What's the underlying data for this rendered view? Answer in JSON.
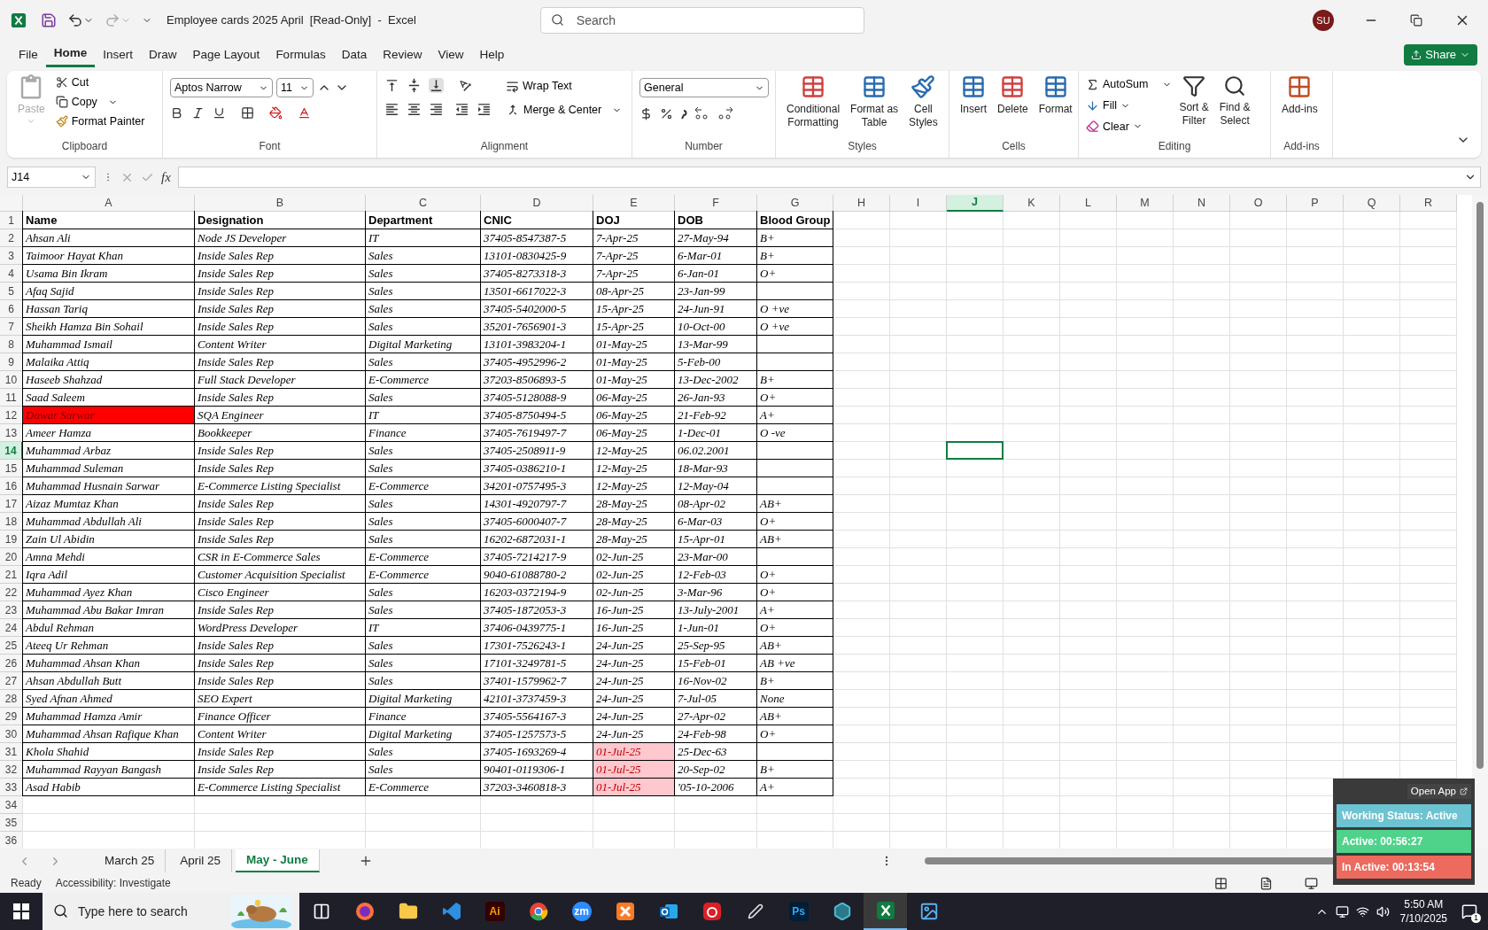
{
  "title_bar": {
    "title": "Employee cards 2025 April  [Read-Only]  -  Excel",
    "search": {
      "placeholder": "Search"
    },
    "avatar": "SU"
  },
  "menu_tabs": [
    {
      "label": "File",
      "selected": false
    },
    {
      "label": "Home",
      "selected": true
    },
    {
      "label": "Insert",
      "selected": false
    },
    {
      "label": "Draw",
      "selected": false
    },
    {
      "label": "Page Layout",
      "selected": false
    },
    {
      "label": "Formulas",
      "selected": false
    },
    {
      "label": "Data",
      "selected": false
    },
    {
      "label": "Review",
      "selected": false
    },
    {
      "label": "View",
      "selected": false
    },
    {
      "label": "Help",
      "selected": false
    }
  ],
  "share": "Share",
  "ribbon": {
    "clipboard": {
      "label": "Clipboard",
      "paste": {
        "label": "Paste",
        "disabled": true
      },
      "cut": "Cut",
      "copy": "Copy",
      "format_painter": "Format Painter"
    },
    "font": {
      "label": "Font",
      "font_name": "Aptos Narrow",
      "font_size": "11"
    },
    "alignment": {
      "label": "Alignment",
      "wrap_text": "Wrap Text",
      "merge_center": "Merge & Center"
    },
    "number": {
      "label": "Number",
      "format": "General"
    },
    "styles": {
      "label": "Styles",
      "conditional_formatting": "Conditional\nFormatting",
      "format_as_table": "Format as\nTable",
      "cell_styles": "Cell\nStyles"
    },
    "cells": {
      "label": "Cells",
      "insert": "Insert",
      "delete": "Delete",
      "format": "Format"
    },
    "editing": {
      "label": "Editing",
      "autosum": "AutoSum",
      "fill": "Fill",
      "clear": "Clear",
      "sort_filter": "Sort &\nFilter",
      "find_select": "Find &\nSelect"
    },
    "addins": {
      "label": "Add-ins",
      "addins": "Add-ins"
    }
  },
  "formula_bar": {
    "name_box": "J14",
    "function_label": "fx"
  },
  "sheet": {
    "columns": [
      {
        "label": "A",
        "selected": false
      },
      {
        "label": "B",
        "selected": false
      },
      {
        "label": "C",
        "selected": false
      },
      {
        "label": "D",
        "selected": false
      },
      {
        "label": "E",
        "selected": false
      },
      {
        "label": "F",
        "selected": false
      },
      {
        "label": "G",
        "selected": false
      },
      {
        "label": "H",
        "selected": false
      },
      {
        "label": "I",
        "selected": false
      },
      {
        "label": "J",
        "selected": true
      },
      {
        "label": "K",
        "selected": false
      },
      {
        "label": "L",
        "selected": false
      },
      {
        "label": "M",
        "selected": false
      },
      {
        "label": "N",
        "selected": false
      },
      {
        "label": "O",
        "selected": false
      },
      {
        "label": "P",
        "selected": false
      },
      {
        "label": "Q",
        "selected": false
      },
      {
        "label": "R",
        "selected": false
      }
    ],
    "header_row": {
      "number": "1",
      "selected": false,
      "name": "Name",
      "designation": "Designation",
      "department": "Department",
      "cnic": "CNIC",
      "doj": "DOJ",
      "dob": "DOB",
      "blood_group": "Blood Group"
    },
    "rows": [
      {
        "number": "2",
        "selected": false,
        "name_highlight": false,
        "doj_highlight": false,
        "name": "Ahsan Ali",
        "designation": "Node JS Developer",
        "department": "IT",
        "cnic": "37405-8547387-5",
        "doj": "7-Apr-25",
        "dob": "27-May-94",
        "blood_group": "B+"
      },
      {
        "number": "3",
        "selected": false,
        "name_highlight": false,
        "doj_highlight": false,
        "name": "Taimoor Hayat Khan",
        "designation": "Inside Sales Rep",
        "department": "Sales",
        "cnic": "13101-0830425-9",
        "doj": "7-Apr-25",
        "dob": "6-Mar-01",
        "blood_group": "B+"
      },
      {
        "number": "4",
        "selected": false,
        "name_highlight": false,
        "doj_highlight": false,
        "name": "Usama Bin Ikram",
        "designation": "Inside Sales Rep",
        "department": "Sales",
        "cnic": "37405-8273318-3",
        "doj": "7-Apr-25",
        "dob": "6-Jan-01",
        "blood_group": "O+"
      },
      {
        "number": "5",
        "selected": false,
        "name_highlight": false,
        "doj_highlight": false,
        "name": "Afaq Sajid",
        "designation": "Inside Sales Rep",
        "department": "Sales",
        "cnic": "13501-6617022-3",
        "doj": "08-Apr-25",
        "dob": "23-Jan-99"
      },
      {
        "number": "6",
        "selected": false,
        "name_highlight": false,
        "doj_highlight": false,
        "name": "Hassan Tariq",
        "designation": "Inside Sales Rep",
        "department": "Sales",
        "cnic": "37405-5402000-5",
        "doj": "15-Apr-25",
        "dob": "24-Jun-91",
        "blood_group": "O +ve"
      },
      {
        "number": "7",
        "selected": false,
        "name_highlight": false,
        "doj_highlight": false,
        "name": "Sheikh Hamza Bin Sohail",
        "designation": "Inside Sales Rep",
        "department": "Sales",
        "cnic": "35201-7656901-3",
        "doj": "15-Apr-25",
        "dob": "10-Oct-00",
        "blood_group": "O +ve"
      },
      {
        "number": "8",
        "selected": false,
        "name_highlight": false,
        "doj_highlight": false,
        "name": "Muhammad Ismail",
        "designation": "Content Writer",
        "department": "Digital Marketing",
        "cnic": "13101-3983204-1",
        "doj": "01-May-25",
        "dob": "13-Mar-99"
      },
      {
        "number": "9",
        "selected": false,
        "name_highlight": false,
        "doj_highlight": false,
        "name": "Malaika Attiq",
        "designation": "Inside Sales Rep",
        "department": "Sales",
        "cnic": "37405-4952996-2",
        "doj": "01-May-25",
        "dob": "5-Feb-00"
      },
      {
        "number": "10",
        "selected": false,
        "name_highlight": false,
        "doj_highlight": false,
        "name": "Haseeb Shahzad",
        "designation": "Full Stack Developer",
        "department": "E-Commerce",
        "cnic": "37203-8506893-5",
        "doj": "01-May-25",
        "dob": "13-Dec-2002",
        "blood_group": "B+"
      },
      {
        "number": "11",
        "selected": false,
        "name_highlight": false,
        "doj_highlight": false,
        "name": "Saad Saleem",
        "designation": "Inside Sales Rep",
        "department": "Sales",
        "cnic": "37405-5128088-9",
        "doj": "06-May-25",
        "dob": "26-Jan-93",
        "blood_group": "O+"
      },
      {
        "number": "12",
        "selected": false,
        "name_highlight": true,
        "doj_highlight": false,
        "name": "Dawar Sarwar",
        "designation": "SQA Engineer",
        "department": "IT",
        "cnic": "37405-8750494-5",
        "doj": "06-May-25",
        "dob": "21-Feb-92",
        "blood_group": "A+"
      },
      {
        "number": "13",
        "selected": false,
        "name_highlight": false,
        "doj_highlight": false,
        "name": "Ameer Hamza",
        "designation": "Bookkeeper",
        "department": "Finance",
        "cnic": "37405-7619497-7",
        "doj": "06-May-25",
        "dob": "1-Dec-01",
        "blood_group": "O -ve"
      },
      {
        "number": "14",
        "selected": true,
        "name_highlight": false,
        "doj_highlight": false,
        "name": "Muhammad Arbaz",
        "designation": "Inside Sales Rep",
        "department": "Sales",
        "cnic": "37405-2508911-9",
        "doj": "12-May-25",
        "dob": "06.02.2001"
      },
      {
        "number": "15",
        "selected": false,
        "name_highlight": false,
        "doj_highlight": false,
        "name": "Muhammad Suleman",
        "designation": "Inside Sales Rep",
        "department": "Sales",
        "cnic": "37405-0386210-1",
        "doj": "12-May-25",
        "dob": "18-Mar-93"
      },
      {
        "number": "16",
        "selected": false,
        "name_highlight": false,
        "doj_highlight": false,
        "name": "Muhammad Husnain Sarwar",
        "designation": "E-Commerce Listing Specialist",
        "department": "E-Commerce",
        "cnic": "34201-0757495-3",
        "doj": "12-May-25",
        "dob": "12-May-04"
      },
      {
        "number": "17",
        "selected": false,
        "name_highlight": false,
        "doj_highlight": false,
        "name": "Aizaz Mumtaz Khan",
        "designation": "Inside Sales Rep",
        "department": "Sales",
        "cnic": "14301-4920797-7",
        "doj": "28-May-25",
        "dob": "08-Apr-02",
        "blood_group": "AB+"
      },
      {
        "number": "18",
        "selected": false,
        "name_highlight": false,
        "doj_highlight": false,
        "name": "Muhammad Abdullah Ali",
        "designation": "Inside Sales Rep",
        "department": "Sales",
        "cnic": "37405-6000407-7",
        "doj": "28-May-25",
        "dob": "6-Mar-03",
        "blood_group": "O+"
      },
      {
        "number": "19",
        "selected": false,
        "name_highlight": false,
        "doj_highlight": false,
        "name": "Zain Ul Abidin",
        "designation": "Inside Sales Rep",
        "department": "Sales",
        "cnic": "16202-6872031-1",
        "doj": "28-May-25",
        "dob": "15-Apr-01",
        "blood_group": "AB+"
      },
      {
        "number": "20",
        "selected": false,
        "name_highlight": false,
        "doj_highlight": false,
        "name": "Amna Mehdi",
        "designation": "CSR in E-Commerce Sales",
        "department": "E-Commerce",
        "cnic": "37405-7214217-9",
        "doj": "02-Jun-25",
        "dob": "23-Mar-00"
      },
      {
        "number": "21",
        "selected": false,
        "name_highlight": false,
        "doj_highlight": false,
        "name": "Iqra Adil",
        "designation": "Customer Acquisition Specialist",
        "department": "E-Commerce",
        "cnic": "9040-61088780-2",
        "doj": "02-Jun-25",
        "dob": "12-Feb-03",
        "blood_group": "O+"
      },
      {
        "number": "22",
        "selected": false,
        "name_highlight": false,
        "doj_highlight": false,
        "name": "Muhammad Ayez Khan",
        "designation": "Cisco Engineer",
        "department": "Sales",
        "cnic": "16203-0372194-9",
        "doj": "02-Jun-25",
        "dob": "3-Mar-96",
        "blood_group": "O+"
      },
      {
        "number": "23",
        "selected": false,
        "name_highlight": false,
        "doj_highlight": false,
        "name": "Muhammad Abu Bakar Imran",
        "designation": "Inside Sales Rep",
        "department": "Sales",
        "cnic": "37405-1872053-3",
        "doj": "16-Jun-25",
        "dob": "13-July-2001",
        "blood_group": "A+"
      },
      {
        "number": "24",
        "selected": false,
        "name_highlight": false,
        "doj_highlight": false,
        "name": "Abdul Rehman",
        "designation": "WordPress Developer",
        "department": "IT",
        "cnic": "37406-0439775-1",
        "doj": "16-Jun-25",
        "dob": "1-Jun-01",
        "blood_group": "O+"
      },
      {
        "number": "25",
        "selected": false,
        "name_highlight": false,
        "doj_highlight": false,
        "name": "Ateeq Ur Rehman",
        "designation": "Inside Sales Rep",
        "department": "Sales",
        "cnic": "17301-7526243-1",
        "doj": "24-Jun-25",
        "dob": "25-Sep-95",
        "blood_group": "AB+"
      },
      {
        "number": "26",
        "selected": false,
        "name_highlight": false,
        "doj_highlight": false,
        "name": "Muhammad Ahsan Khan",
        "designation": "Inside Sales Rep",
        "department": "Sales",
        "cnic": "17101-3249781-5",
        "doj": "24-Jun-25",
        "dob": "15-Feb-01",
        "blood_group": "AB +ve"
      },
      {
        "number": "27",
        "selected": false,
        "name_highlight": false,
        "doj_highlight": false,
        "name": "Ahsan Abdullah Butt",
        "designation": "Inside Sales Rep",
        "department": "Sales",
        "cnic": "37401-1579962-7",
        "doj": "24-Jun-25",
        "dob": "16-Nov-02",
        "blood_group": "B+"
      },
      {
        "number": "28",
        "selected": false,
        "name_highlight": false,
        "doj_highlight": false,
        "name": "Syed Afnan Ahmed",
        "designation": "SEO Expert",
        "department": "Digital Marketing",
        "cnic": "42101-3737459-3",
        "doj": "24-Jun-25",
        "dob": "7-Jul-05",
        "blood_group": "None"
      },
      {
        "number": "29",
        "selected": false,
        "name_highlight": false,
        "doj_highlight": false,
        "name": "Muhammad Hamza Amir",
        "designation": "Finance Officer",
        "department": "Finance",
        "cnic": "37405-5564167-3",
        "doj": "24-Jun-25",
        "dob": "27-Apr-02",
        "blood_group": "AB+"
      },
      {
        "number": "30",
        "selected": false,
        "name_highlight": false,
        "doj_highlight": false,
        "name": "Muhammad Ahsan Rafique Khan",
        "designation": "Content Writer",
        "department": "Digital Marketing",
        "cnic": "37405-1257573-5",
        "doj": "24-Jun-25",
        "dob": "24-Feb-98",
        "blood_group": "O+"
      },
      {
        "number": "31",
        "selected": false,
        "name_highlight": false,
        "doj_highlight": true,
        "name": "Khola Shahid",
        "designation": "Inside Sales Rep",
        "department": "Sales",
        "cnic": "37405-1693269-4",
        "doj": "01-Jul-25",
        "dob": "25-Dec-63"
      },
      {
        "number": "32",
        "selected": false,
        "name_highlight": false,
        "doj_highlight": true,
        "name": "Muhammad Rayyan Bangash",
        "designation": "Inside Sales Rep",
        "department": "Sales",
        "cnic": "90401-0119306-1",
        "doj": "01-Jul-25",
        "dob": "20-Sep-02",
        "blood_group": "B+"
      },
      {
        "number": "33",
        "selected": false,
        "name_highlight": false,
        "doj_highlight": true,
        "name": "Asad Habib",
        "designation": "E-Commerce Listing Specialist",
        "department": "E-Commerce",
        "cnic": "37203-3460818-3",
        "doj": "01-Jul-25",
        "dob": "'05-10-2006",
        "blood_group": "A+"
      },
      {
        "number": "34",
        "selected": false
      },
      {
        "number": "35",
        "selected": false
      },
      {
        "number": "36",
        "selected": false
      }
    ]
  },
  "sheet_tabs": [
    {
      "label": "March 25",
      "selected": false
    },
    {
      "label": "April 25",
      "selected": false
    },
    {
      "label": "May - June",
      "selected": true
    }
  ],
  "status_bar": {
    "ready": "Ready",
    "accessibility": "Accessibility: Investigate"
  },
  "tracker": {
    "open_app": "Open App",
    "status": "Working Status: Active",
    "active": "Active: 00:56:27",
    "inactive": "In Active: 00:13:54"
  },
  "taskbar": {
    "search": {
      "placeholder": "Type here to search"
    },
    "apps": [
      {
        "kind": "taskview",
        "selected": false
      },
      {
        "kind": "firefox",
        "selected": false
      },
      {
        "kind": "explorer",
        "selected": false
      },
      {
        "kind": "vscode",
        "selected": false
      },
      {
        "kind": "badge",
        "label": "Ai",
        "selected": false
      },
      {
        "kind": "chrome",
        "selected": false
      },
      {
        "kind": "badge",
        "label": "zm",
        "selected": false
      },
      {
        "kind": "xampp",
        "selected": false
      },
      {
        "kind": "outlook",
        "selected": false
      },
      {
        "kind": "cloud",
        "selected": false
      },
      {
        "kind": "pen",
        "selected": false
      },
      {
        "kind": "badge",
        "label": "Ps",
        "selected": false
      },
      {
        "kind": "hexagon",
        "selected": false
      },
      {
        "kind": "excel",
        "selected": true
      },
      {
        "kind": "photos",
        "selected": false
      }
    ],
    "time": "5:50 AM",
    "date": "7/10/2025",
    "notifications": "1"
  }
}
